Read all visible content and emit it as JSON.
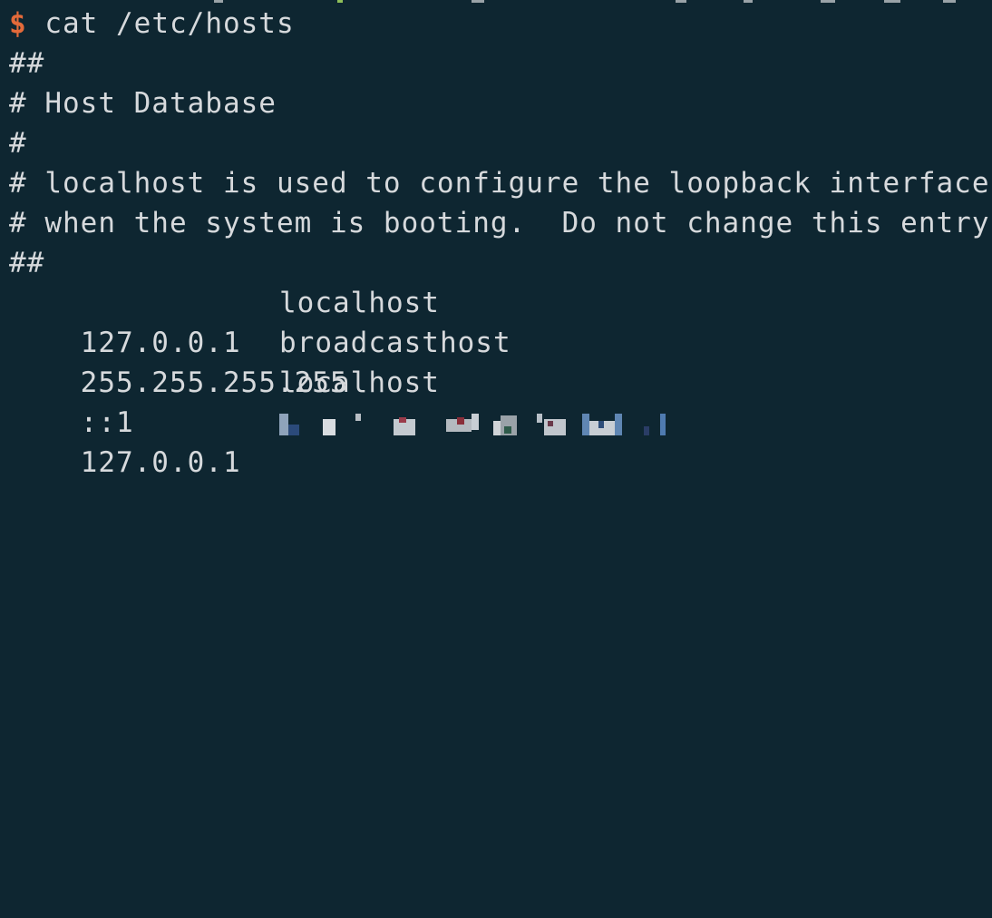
{
  "terminal": {
    "prompt_symbol": "$",
    "command": "cat /etc/hosts",
    "prompt_color": "#e36a3a",
    "background_color": "#0e2631",
    "text_color": "#d6d9dc",
    "comments": [
      "##",
      "# Host Database",
      "#",
      "# localhost is used to configure the loopback interface",
      "# when the system is booting.  Do not change this entry.",
      "##"
    ],
    "entries": [
      {
        "ip": "127.0.0.1",
        "host": "localhost"
      },
      {
        "ip": "255.255.255.255",
        "host": "broadcasthost"
      },
      {
        "ip": "::1",
        "host": "localhost"
      },
      {
        "ip": "127.0.0.1",
        "host": ""
      }
    ]
  }
}
